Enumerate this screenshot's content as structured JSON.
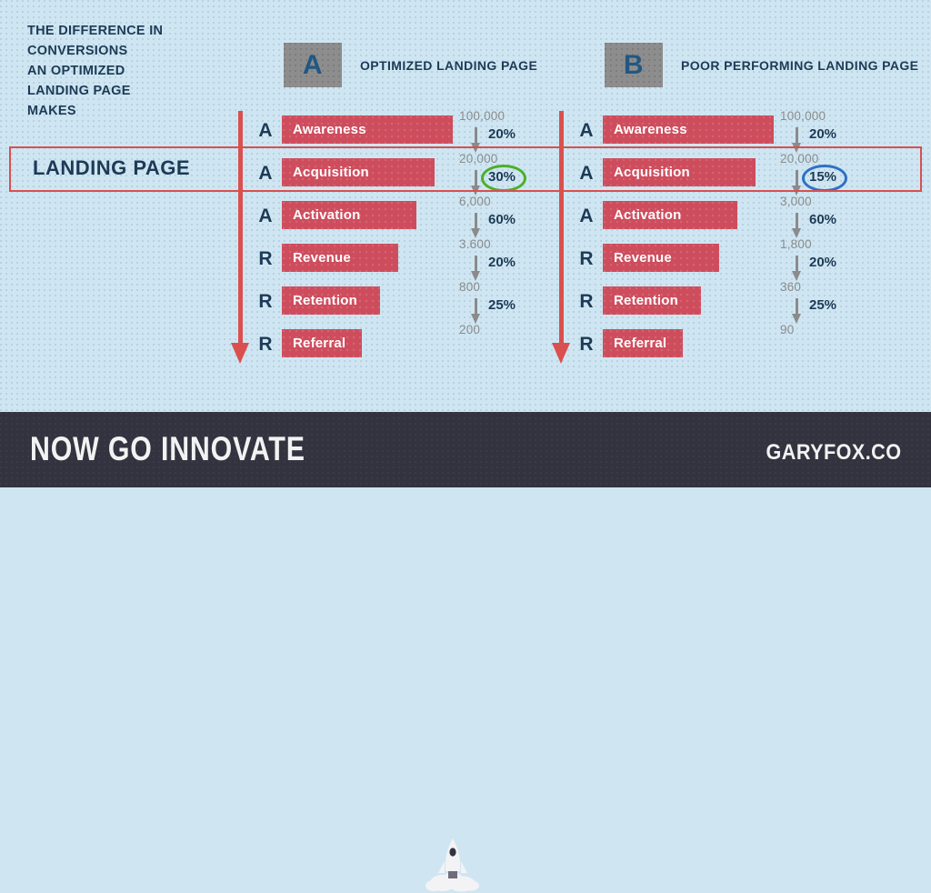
{
  "colors": {
    "background": "#cfe6f2",
    "bar": "#ce4d5d",
    "accent_red": "#d9504f",
    "dark_navy": "#1d3a56",
    "footer_bg": "#32333f",
    "grey_box": "#8d8d8d",
    "grey_text": "#8b8b8b",
    "circle_green": "#4caf2a",
    "circle_blue": "#2f71c4"
  },
  "headline": {
    "lines": [
      "THE DIFFERENCE IN",
      "CONVERSIONS",
      "AN OPTIMIZED",
      "LANDING PAGE",
      "MAKES"
    ]
  },
  "landing_page_label": "LANDING PAGE",
  "panels": [
    {
      "badge": "A",
      "title": "OPTIMIZED LANDING PAGE",
      "stages": [
        {
          "letter": "A",
          "label": "Awareness"
        },
        {
          "letter": "A",
          "label": "Acquisition"
        },
        {
          "letter": "A",
          "label": "Activation"
        },
        {
          "letter": "R",
          "label": "Revenue"
        },
        {
          "letter": "R",
          "label": "Retention"
        },
        {
          "letter": "R",
          "label": "Referral"
        }
      ],
      "counts": [
        "100,000",
        "20,000",
        "6,000",
        "3.600",
        "800",
        "200"
      ],
      "percents": [
        "20%",
        "30%",
        "60%",
        "20%",
        "25%"
      ],
      "highlight_index": 1,
      "highlight_color": "green"
    },
    {
      "badge": "B",
      "title": "POOR PERFORMING LANDING PAGE",
      "stages": [
        {
          "letter": "A",
          "label": "Awareness"
        },
        {
          "letter": "A",
          "label": "Acquisition"
        },
        {
          "letter": "A",
          "label": "Activation"
        },
        {
          "letter": "R",
          "label": "Revenue"
        },
        {
          "letter": "R",
          "label": "Retention"
        },
        {
          "letter": "R",
          "label": "Referral"
        }
      ],
      "counts": [
        "100,000",
        "20,000",
        "3,000",
        "1,800",
        "360",
        "90"
      ],
      "percents": [
        "20%",
        "15%",
        "60%",
        "20%",
        "25%"
      ],
      "highlight_index": 1,
      "highlight_color": "blue"
    }
  ],
  "bar_widths": [
    188,
    168,
    148,
    128,
    108,
    88
  ],
  "footer": {
    "tagline": "NOW GO INNOVATE",
    "brand": "GARYFOX.CO",
    "icon": "rocket-icon"
  }
}
